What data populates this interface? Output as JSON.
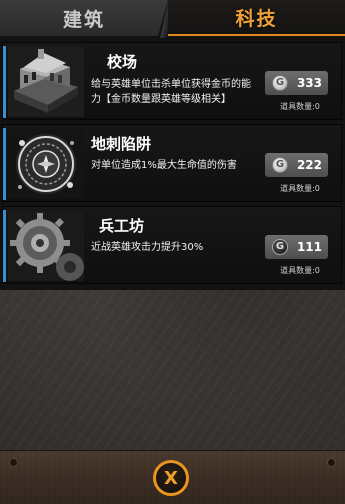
{
  "tabs": [
    {
      "label": "建筑",
      "active": false
    },
    {
      "label": "科技",
      "active": true
    }
  ],
  "items": [
    {
      "name": "校场",
      "description": "给与英雄单位击杀单位获得金币的能力【金币数量跟英雄等级相关】",
      "cost": "333",
      "currency_icon": "silver-coin-icon",
      "owned_label": "道具数量:0"
    },
    {
      "name": "地刺陷阱",
      "description": "对单位造成1%最大生命值的伤害",
      "cost": "222",
      "currency_icon": "silver-coin-icon",
      "owned_label": "道具数量:0"
    },
    {
      "name": "兵工坊",
      "description": "近战英雄攻击力提升30%",
      "cost": "111",
      "currency_icon": "dark-coin-icon",
      "owned_label": "道具数量:0"
    }
  ],
  "close_button": {
    "label": "X"
  },
  "colors": {
    "tab_active_text": "#f0a23a",
    "accent_blue": "#3a8fd0",
    "close_ring": "#e8951f",
    "bottom_bar": "#3d2e25"
  }
}
